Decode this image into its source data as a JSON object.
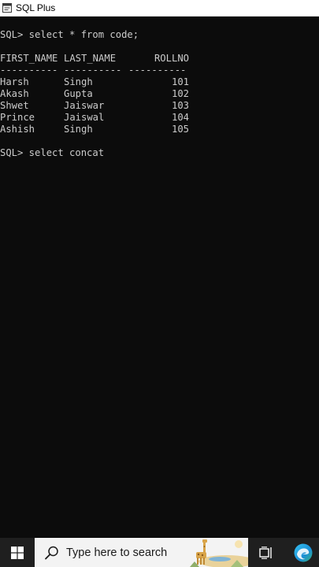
{
  "window": {
    "title": "SQL Plus",
    "icon": "sqlplus-app-icon"
  },
  "console": {
    "prompt1": "SQL> select * from code;",
    "headers": [
      "FIRST_NAME",
      "LAST_NAME",
      "ROLLNO"
    ],
    "separators": [
      "----------",
      "----------",
      "----------"
    ],
    "rows": [
      [
        "Harsh",
        "Singh",
        "101"
      ],
      [
        "Akash",
        "Gupta",
        "102"
      ],
      [
        "Shwet",
        "Jaiswar",
        "103"
      ],
      [
        "Prince",
        "Jaiswal",
        "104"
      ],
      [
        "Ashish",
        "Singh",
        "105"
      ]
    ],
    "prompt2": "SQL> select concat"
  },
  "taskbar": {
    "search_placeholder": "Type here to search",
    "icons": [
      "windows-start-icon",
      "search-icon",
      "task-view-icon",
      "edge-browser-icon"
    ],
    "colors": {
      "background": "#1f1f1f",
      "search_box": "#f3f3f3"
    }
  },
  "colors": {
    "console_bg": "#0c0c0c",
    "console_text": "#cccccc"
  }
}
